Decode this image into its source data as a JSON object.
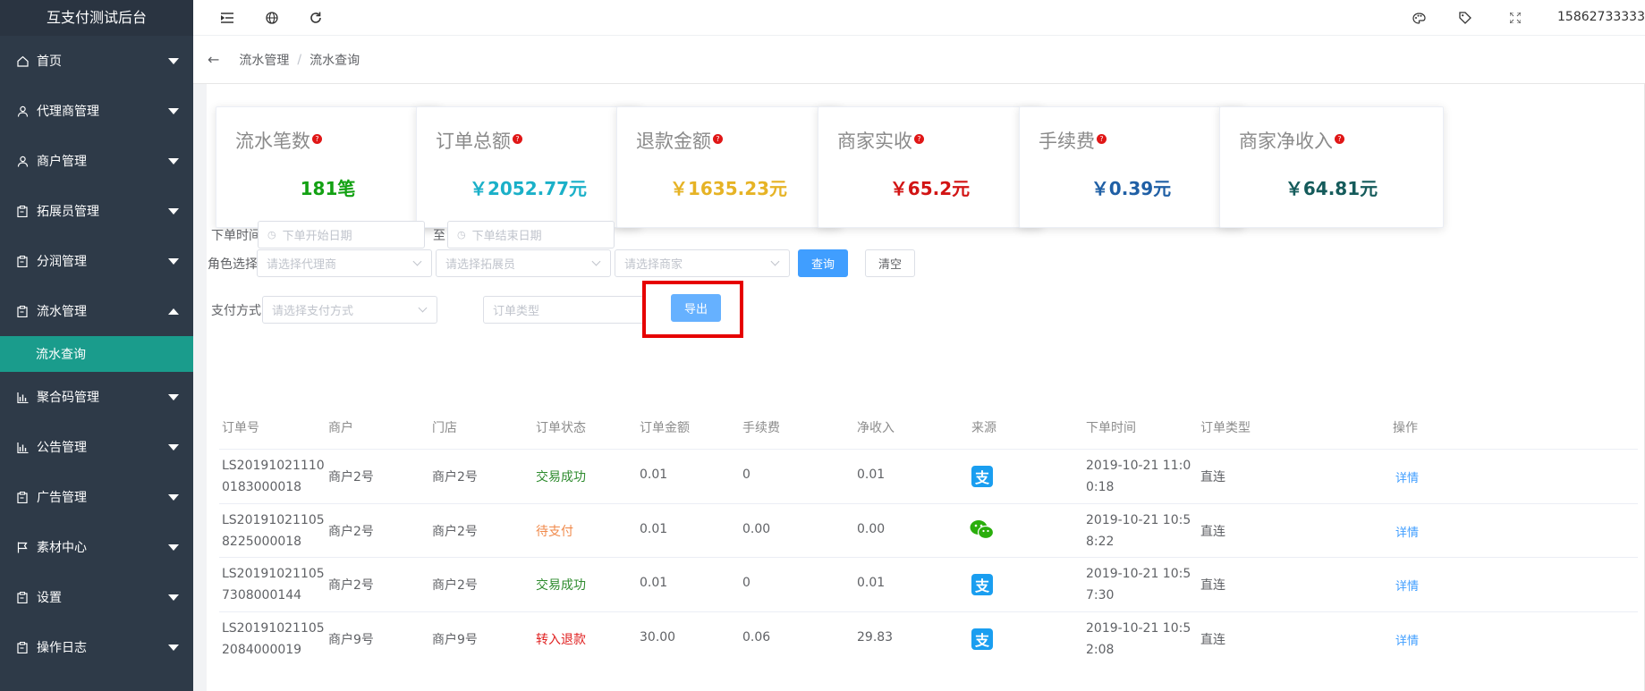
{
  "app": {
    "title": "互支付测试后台",
    "user_phone": "15862733333"
  },
  "sidebar": {
    "items": [
      {
        "label": "首页",
        "icon": "home-icon"
      },
      {
        "label": "代理商管理",
        "icon": "user-icon"
      },
      {
        "label": "商户管理",
        "icon": "user-icon"
      },
      {
        "label": "拓展员管理",
        "icon": "clipboard-icon"
      },
      {
        "label": "分润管理",
        "icon": "clipboard-icon"
      },
      {
        "label": "流水管理",
        "icon": "clipboard-icon",
        "expanded": true
      },
      {
        "label": "聚合码管理",
        "icon": "bank-icon"
      },
      {
        "label": "公告管理",
        "icon": "bank-icon"
      },
      {
        "label": "广告管理",
        "icon": "clipboard-icon"
      },
      {
        "label": "素材中心",
        "icon": "flag-icon"
      },
      {
        "label": "设置",
        "icon": "clipboard-icon"
      },
      {
        "label": "操作日志",
        "icon": "clipboard-icon"
      }
    ],
    "active_sub": "流水查询"
  },
  "breadcrumb": {
    "items": [
      "流水管理",
      "流水查询"
    ],
    "separator": "/"
  },
  "stats": [
    {
      "label": "流水笔数",
      "value": "181笔",
      "color": "#13a113"
    },
    {
      "label": "订单总额",
      "value": "￥2052.77元",
      "color": "#1ab0c8"
    },
    {
      "label": "退款金额",
      "value": "￥1635.23元",
      "color": "#e6b325"
    },
    {
      "label": "商家实收",
      "value": "￥65.2元",
      "color": "#d21414"
    },
    {
      "label": "手续费",
      "value": "￥0.39元",
      "color": "#1f5fa5"
    },
    {
      "label": "商家净收入",
      "value": "￥64.81元",
      "color": "#155b5b"
    }
  ],
  "filters": {
    "order_time_label": "下单时间",
    "start_placeholder": "下单开始日期",
    "to": "至",
    "end_placeholder": "下单结束日期",
    "role_label": "角色选择",
    "agent_placeholder": "请选择代理商",
    "staff_placeholder": "请选择拓展员",
    "merchant_placeholder": "请选择商家",
    "query": "查询",
    "clear": "清空",
    "pay_label": "支付方式",
    "pay_placeholder": "请选择支付方式",
    "order_type_placeholder": "订单类型",
    "export": "导出"
  },
  "table": {
    "columns": [
      "订单号",
      "商户",
      "门店",
      "订单状态",
      "订单金额",
      "手续费",
      "净收入",
      "来源",
      "下单时间",
      "订单类型",
      "操作"
    ],
    "rows": [
      {
        "order_no": "LS201910211100183000018",
        "merchant": "商户2号",
        "store": "商户2号",
        "status": "交易成功",
        "status_color": "#2e8b2e",
        "amount": "0.01",
        "fee": "0",
        "net": "0.01",
        "source": "alipay",
        "source_glyph": "支",
        "time": "2019-10-21 11:00:18",
        "type": "直连",
        "action": "详情"
      },
      {
        "order_no": "LS2019102110582250000​18",
        "merchant": "商户2号",
        "store": "商户2号",
        "status": "待支付",
        "status_color": "#f08a4b",
        "amount": "0.01",
        "fee": "0.00",
        "net": "0.00",
        "source": "wechat",
        "source_glyph": "",
        "time": "2019-10-21 10:58:22",
        "type": "直连",
        "action": "详情"
      },
      {
        "order_no": "LS201910211057308000144",
        "merchant": "商户2号",
        "store": "商户2号",
        "status": "交易成功",
        "status_color": "#2e8b2e",
        "amount": "0.01",
        "fee": "0",
        "net": "0.01",
        "source": "alipay",
        "source_glyph": "支",
        "time": "2019-10-21 10:57:30",
        "type": "直连",
        "action": "详情"
      },
      {
        "order_no": "LS201910211052084000019",
        "merchant": "商户9号",
        "store": "商户9号",
        "status": "转入退款",
        "status_color": "#e02020",
        "amount": "30.00",
        "fee": "0.06",
        "net": "29.83",
        "source": "alipay",
        "source_glyph": "支",
        "time": "2019-10-21 10:52:08",
        "type": "直连",
        "action": "详情"
      }
    ]
  }
}
